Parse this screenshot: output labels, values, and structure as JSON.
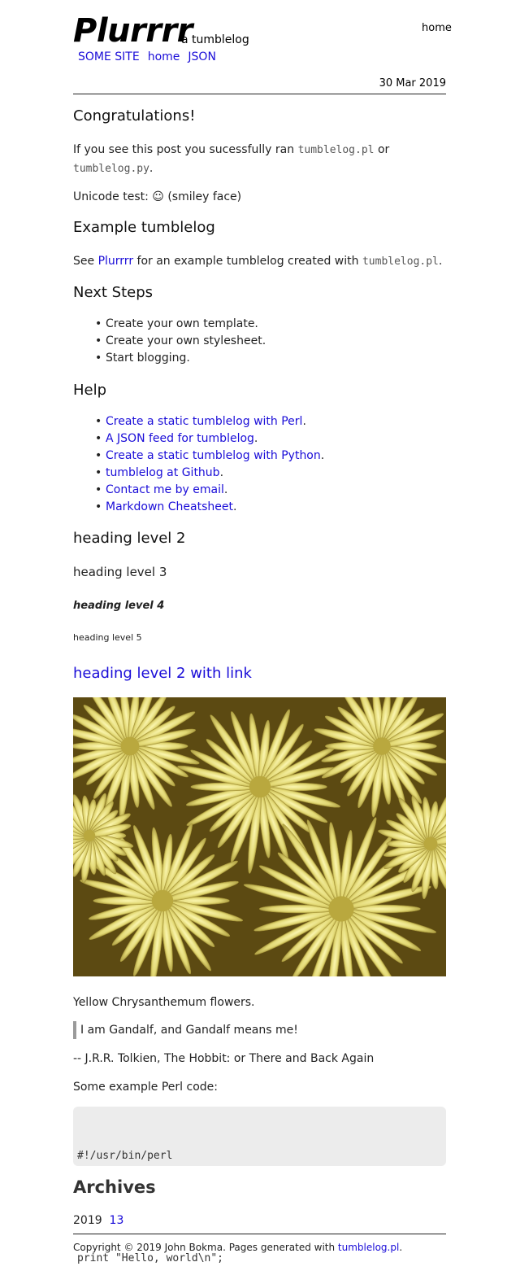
{
  "header": {
    "title": "Plurrrr",
    "subtitle": "a tumblelog",
    "top_link": "home",
    "nav": [
      "SOME SITE",
      "home",
      "JSON"
    ],
    "date": "30 Mar 2019"
  },
  "post": {
    "h_congrats": "Congratulations!",
    "congrats_p_pre": "If you see this post you sucessfully ran",
    "congrats_code1": "tumblelog.pl",
    "congrats_p_or": "or",
    "congrats_code2": "tumblelog.py",
    "congrats_p_end": ".",
    "unicode_line": "Unicode test: ☺ (smiley face)",
    "h_example": "Example tumblelog",
    "example_pre": "See",
    "example_link": "Plurrrr",
    "example_mid": "for an example tumblelog created with",
    "example_code": "tumblelog.pl",
    "example_end": ".",
    "h_next": "Next Steps",
    "next_steps": [
      "Create your own template.",
      "Create your own stylesheet.",
      "Start blogging."
    ],
    "h_help": "Help",
    "help_links": [
      "Create a static tumblelog with Perl",
      "A JSON feed for tumblelog",
      "Create a static tumblelog with Python",
      "tumblelog at Github",
      "Contact me by email",
      "Markdown Cheatsheet"
    ],
    "help_suffix": ".",
    "h_level2": "heading level 2",
    "h_level3": "heading level 3",
    "h_level4": "heading level 4",
    "h_level5": "heading level 5",
    "h_level2_link": "heading level 2 with link",
    "image_caption": "Yellow Chrysanthemum flowers.",
    "quote": "I am Gandalf, and Gandalf means me!",
    "quote_attrib": "-- J.R.R. Tolkien, The Hobbit: or There and Back Again",
    "code_intro": "Some example Perl code:",
    "code_lines": [
      "#!/usr/bin/perl",
      "",
      "print \"Hello, world\\n\";"
    ]
  },
  "archives": {
    "heading": "Archives",
    "year": "2019",
    "count": "13"
  },
  "footer": {
    "text": "Copyright © 2019 John Bokma. Pages generated with",
    "link": "tumblelog.pl",
    "end": "."
  },
  "colors": {
    "link": "#1a0dd8",
    "code_bg": "#ececec",
    "quote_bar": "#9a9a9a"
  }
}
